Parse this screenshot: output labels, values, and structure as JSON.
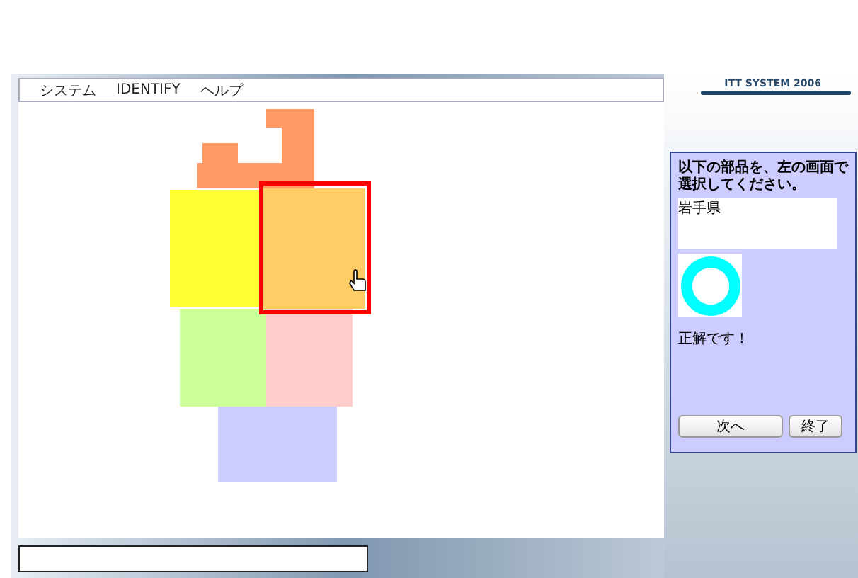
{
  "menu": [
    "システム",
    "IDENTIFY",
    "ヘルプ"
  ],
  "logo": "ITT SYSTEM 2006",
  "map": {
    "regions": [
      {
        "color": "#ff9966",
        "selected": false
      },
      {
        "color": "#ffff33",
        "selected": false
      },
      {
        "color": "#ffcc66",
        "selected": true
      },
      {
        "color": "#ccff99",
        "selected": false
      },
      {
        "color": "#ffcccc",
        "selected": false
      },
      {
        "color": "#ccccff",
        "selected": false
      }
    ]
  },
  "panel": {
    "instruction": "以下の部品を、左の画面で選択してください。",
    "answer": "岩手県",
    "result": {
      "kind": "correct",
      "message": "正解です！"
    },
    "buttons": [
      "次へ",
      "終了"
    ]
  }
}
